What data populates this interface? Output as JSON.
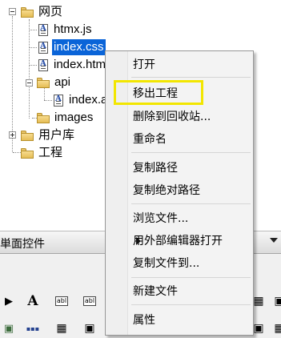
{
  "tree": {
    "nodes": [
      {
        "label": "网页",
        "type": "folder",
        "expanded": true
      },
      {
        "label": "htmx.js",
        "type": "file"
      },
      {
        "label": "index.css",
        "type": "file",
        "selected": true
      },
      {
        "label": "index.htm",
        "type": "file"
      },
      {
        "label": "api",
        "type": "folder",
        "expanded": true
      },
      {
        "label": "index.a",
        "type": "file"
      },
      {
        "label": "images",
        "type": "folder"
      },
      {
        "label": "用户库",
        "type": "folder",
        "expanded": false
      },
      {
        "label": "工程",
        "type": "folder"
      }
    ]
  },
  "toolbox": {
    "title": "単面控件",
    "tools_row1": [
      "▶",
      "A",
      "abl",
      "abl"
    ],
    "tools_row2": [
      "▣",
      "▪▪▪",
      "▦",
      "▣"
    ]
  },
  "context_menu": {
    "items": [
      {
        "label": "打开"
      },
      {
        "label": "移出工程",
        "highlighted": true
      },
      {
        "label": "删除到回收站..."
      },
      {
        "label": "重命名"
      },
      {
        "label": "复制路径"
      },
      {
        "label": "复制绝对路径"
      },
      {
        "label": "浏览文件..."
      },
      {
        "label": "用外部编辑器打开"
      },
      {
        "label": "复制文件到..."
      },
      {
        "label": "新建文件",
        "has_submenu": true
      },
      {
        "label": "属性"
      }
    ],
    "highlight_color": "#f2e600"
  },
  "colors": {
    "selection": "#0a64d8"
  }
}
